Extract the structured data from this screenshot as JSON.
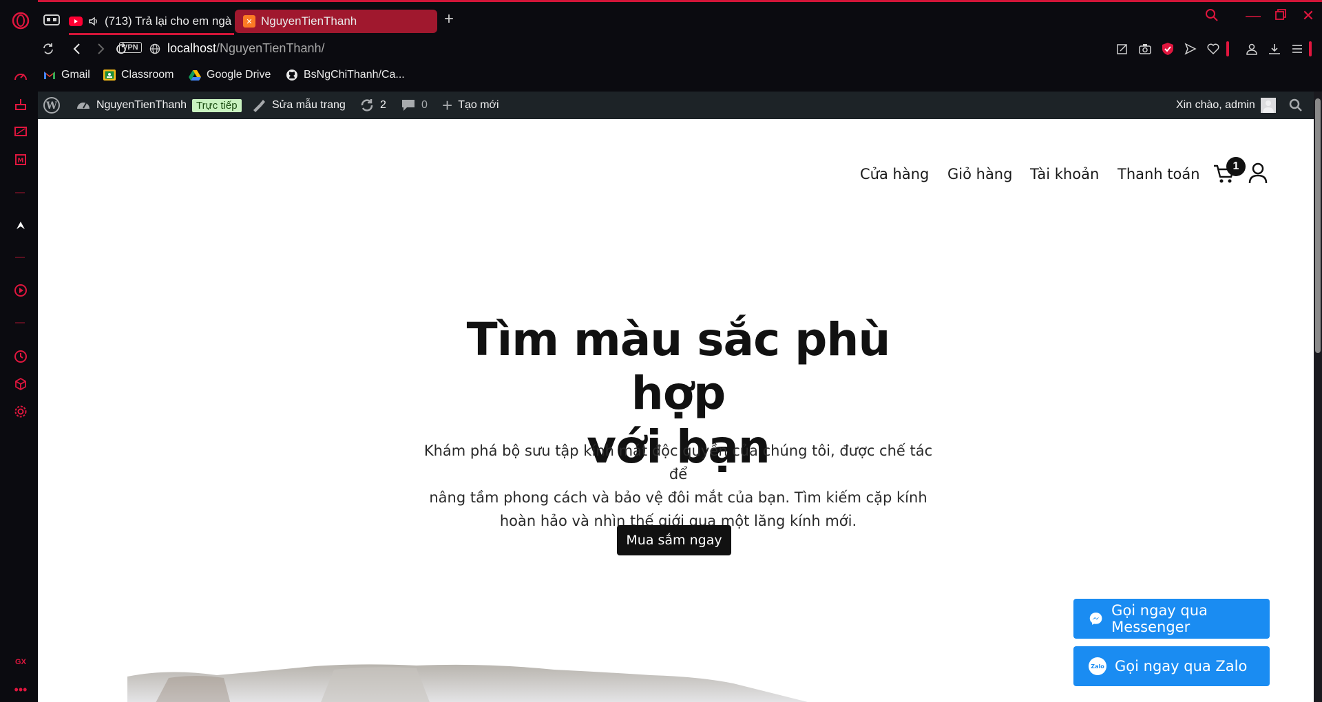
{
  "browser": {
    "tabs": [
      {
        "label": "(713) Trả lại cho em ngà",
        "site": "youtube"
      },
      {
        "label": "NguyenTienThanh",
        "site": "xampp"
      }
    ],
    "address": {
      "vpn_label": "VPN",
      "host": "localhost",
      "path": "/NguyenTienThanh/"
    },
    "bookmarks": [
      {
        "label": "Gmail",
        "icon": "gmail-icon"
      },
      {
        "label": "Classroom",
        "icon": "classroom-icon"
      },
      {
        "label": "Google Drive",
        "icon": "google-drive-icon"
      },
      {
        "label": "BsNgChiThanh/Ca...",
        "icon": "github-icon"
      }
    ],
    "sidebar_bottom_label": "GX",
    "accent": "#e0163e"
  },
  "wp_admin_bar": {
    "site_name": "NguyenTienThanh",
    "live_badge": "Trực tiếp",
    "edit_template": "Sửa mẫu trang",
    "updates_count": "2",
    "comments_count": "0",
    "new_label": "Tạo mới",
    "greeting": "Xin chào, admin"
  },
  "site": {
    "nav": [
      "Cửa hàng",
      "Giỏ hàng",
      "Tài khoản",
      "Thanh toán"
    ],
    "cart_count": "1",
    "hero": {
      "title_line1": "Tìm màu sắc phù hợp",
      "title_line2": "với bạn",
      "text_line1": "Khám phá bộ sưu tập kính mát độc quyền của chúng tôi, được chế tác để",
      "text_line2": "nâng tầm phong cách và bảo vệ đôi mắt của bạn. Tìm kiếm cặp kính",
      "text_line3": "hoàn hảo và nhìn thế giới qua một lăng kính mới.",
      "button": "Mua sắm ngay"
    },
    "contact": {
      "messenger": "Gọi ngay qua Messenger",
      "zalo": "Gọi ngay qua Zalo",
      "zalo_icon_text": "Zalo",
      "color": "#1a8cf2"
    }
  }
}
